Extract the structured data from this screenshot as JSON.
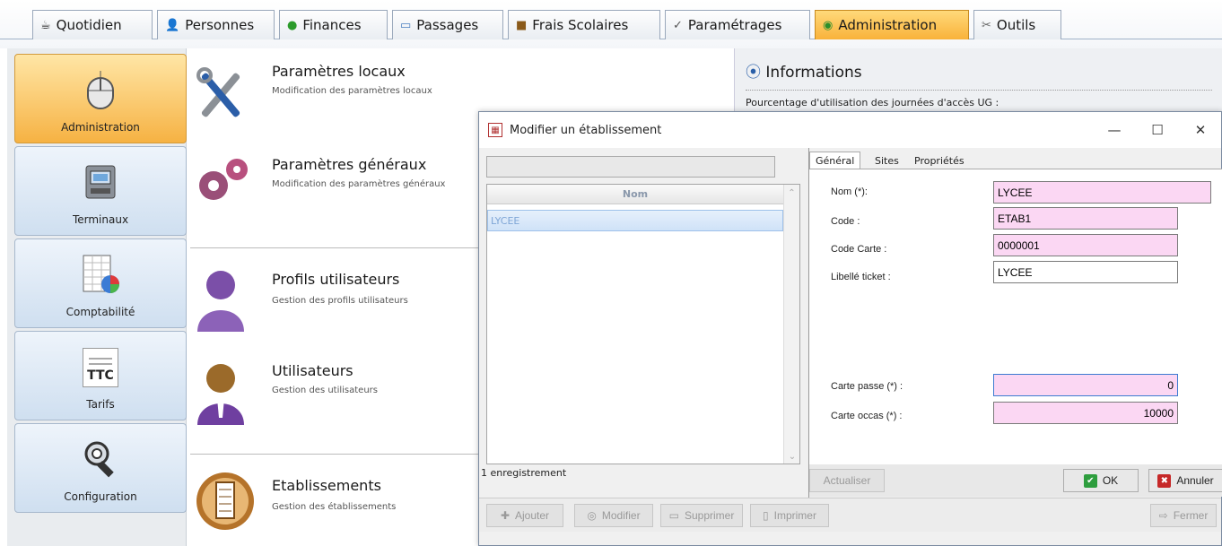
{
  "tabs": [
    {
      "label": "Quotidien",
      "icon": "mug-icon"
    },
    {
      "label": "Personnes",
      "icon": "person-icon"
    },
    {
      "label": "Finances",
      "icon": "money-icon"
    },
    {
      "label": "Passages",
      "icon": "card-icon"
    },
    {
      "label": "Frais Scolaires",
      "icon": "briefcase-icon"
    },
    {
      "label": "Paramétrages",
      "icon": "check-icon"
    },
    {
      "label": "Administration",
      "icon": "gear-icon",
      "active": true
    },
    {
      "label": "Outils",
      "icon": "tools-icon"
    }
  ],
  "sidebar": {
    "items": [
      {
        "label": "Administration",
        "icon": "mouse-icon",
        "active": true
      },
      {
        "label": "Terminaux",
        "icon": "terminal-icon"
      },
      {
        "label": "Comptabilité",
        "icon": "spreadsheet-chart-icon"
      },
      {
        "label": "Tarifs",
        "icon": "ttc-icon",
        "icon_text": "TTC"
      },
      {
        "label": "Configuration",
        "icon": "wrench-icon"
      }
    ]
  },
  "content": {
    "items": [
      {
        "title": "Paramètres locaux",
        "subtitle": "Modification des paramètres locaux",
        "icon": "tools-icon"
      },
      {
        "title": "Paramètres généraux",
        "subtitle": "Modification des paramètres généraux",
        "icon": "gears-icon"
      },
      {
        "title": "Profils utilisateurs",
        "subtitle": "Gestion des profils utilisateurs",
        "icon": "user-profile-icon"
      },
      {
        "title": "Utilisateurs",
        "subtitle": "Gestion des utilisateurs",
        "icon": "user-icon"
      },
      {
        "title": "Etablissements",
        "subtitle": "Gestion des établissements",
        "icon": "building-icon"
      }
    ]
  },
  "info": {
    "title": "Informations",
    "subtitle": "Pourcentage d'utilisation des journées d'accès UG :"
  },
  "dialog": {
    "title": "Modifier un établissement",
    "search_value": "",
    "grid": {
      "column": "Nom",
      "rows": [
        "LYCEE"
      ]
    },
    "record_count": "1 enregistrement",
    "tabs": [
      "Général",
      "Sites",
      "Propriétés"
    ],
    "fields": {
      "nom": {
        "label": "Nom (*):",
        "value": "LYCEE"
      },
      "code": {
        "label": "Code :",
        "value": "ETAB1"
      },
      "code_carte": {
        "label": "Code Carte :",
        "value": "0000001"
      },
      "libelle_ticket": {
        "label": "Libellé ticket :",
        "value": "LYCEE"
      },
      "carte_passe": {
        "label": "Carte passe (*) :",
        "value": "0"
      },
      "carte_occas": {
        "label": "Carte occas (*) :",
        "value": "10000"
      }
    },
    "buttons": {
      "actualiser": "Actualiser",
      "ok": "OK",
      "annuler": "Annuler",
      "ajouter": "Ajouter",
      "modifier": "Modifier",
      "supprimer": "Supprimer",
      "imprimer": "Imprimer",
      "fermer": "Fermer"
    },
    "window_controls": {
      "minimize": "—",
      "maximize": "☐",
      "close": "✕"
    }
  },
  "colors": {
    "active_tab": "#f9b23a",
    "required_field": "#fbd7f3",
    "nav_blue": "#cfdff0"
  }
}
